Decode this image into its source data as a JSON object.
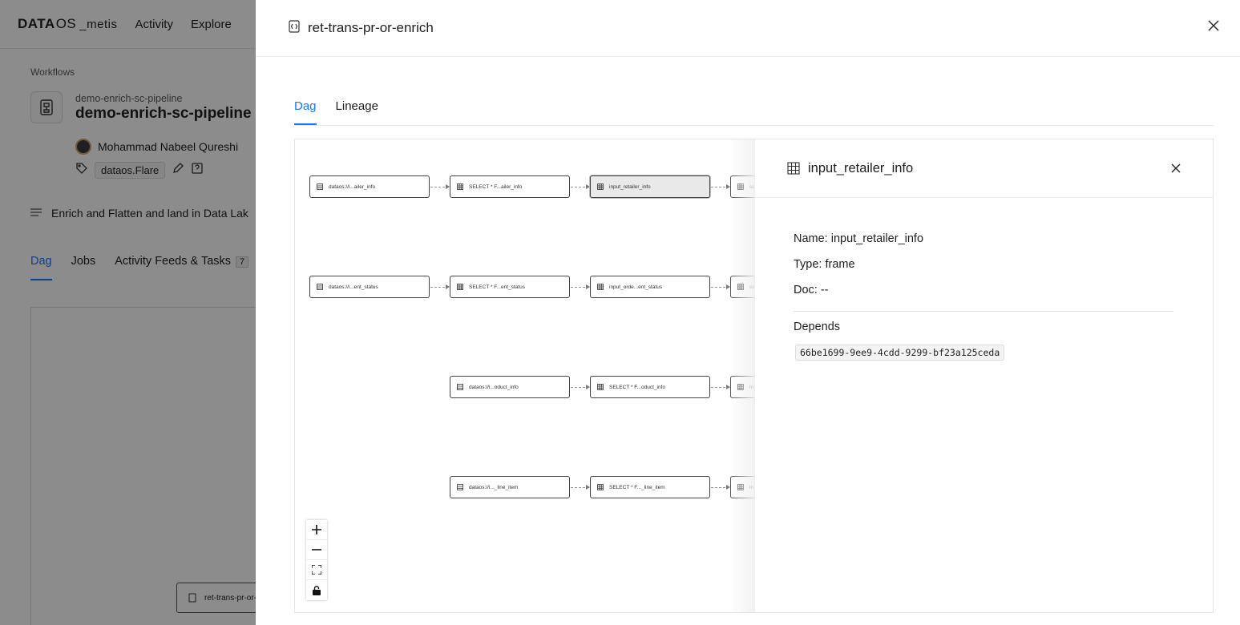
{
  "app": {
    "logo_main": "DATA",
    "logo_os": "OS",
    "logo_app": "_metis",
    "nav": [
      "Activity",
      "Explore"
    ]
  },
  "background": {
    "breadcrumb": "Workflows",
    "workflow_subtitle": "demo-enrich-sc-pipeline",
    "workflow_title": "demo-enrich-sc-pipeline",
    "owner": "Mohammad Nabeel Qureshi",
    "tag": "dataos.Flare",
    "description": "Enrich and Flatten and land in Data Lak",
    "tabs": [
      {
        "label": "Dag"
      },
      {
        "label": "Jobs"
      },
      {
        "label": "Activity Feeds & Tasks",
        "badge": "7"
      }
    ],
    "canvas_node": "ret-trans-pr-or-"
  },
  "drawer": {
    "title": "ret-trans-pr-or-enrich",
    "tabs": [
      {
        "label": "Dag",
        "active": true
      },
      {
        "label": "Lineage",
        "active": false
      }
    ]
  },
  "dag": {
    "rows": [
      [
        "dataos://i...ailer_info",
        "SELECT * F...ailer_info",
        "input_retailer_info",
        "se"
      ],
      [
        "dataos://i...ent_status",
        "SELECT * F...ent_status",
        "input_orde...ent_status",
        "se"
      ],
      [
        "dataos://i...oduct_info",
        "SELECT * F...oduct_info",
        "in"
      ],
      [
        "dataos://i..._line_item",
        "SELECT * F..._line_item",
        "in"
      ]
    ],
    "selected_node": "input_retailer_info",
    "zoom_controls": [
      "+",
      "−",
      "fit",
      "lock"
    ]
  },
  "properties": {
    "title": "input_retailer_info",
    "name_line": "Name: input_retailer_info",
    "type_line": "Type: frame",
    "doc_line": "Doc: --",
    "depends_label": "Depends",
    "depends_id": "66be1699-9ee9-4cdd-9299-bf23a125ceda"
  }
}
